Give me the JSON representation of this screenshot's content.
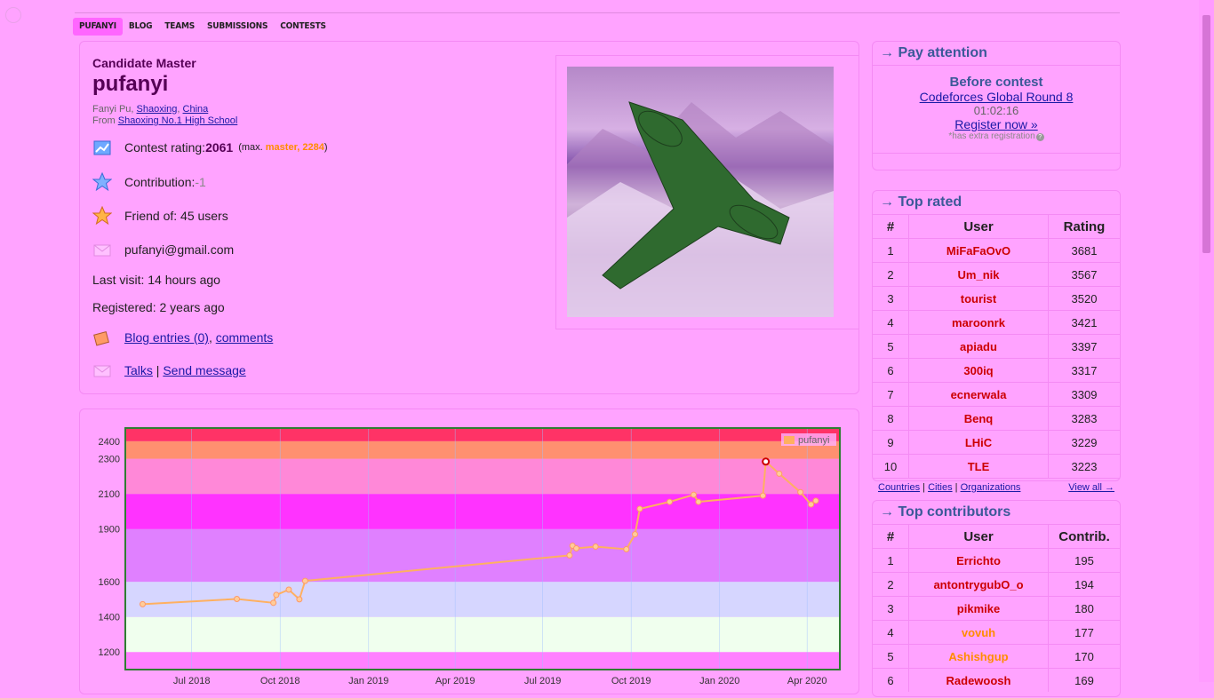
{
  "nav": [
    "PUFANYI",
    "BLOG",
    "TEAMS",
    "SUBMISSIONS",
    "CONTESTS"
  ],
  "profile": {
    "rank": "Candidate Master",
    "handle": "pufanyi",
    "name_prefix": "Fanyi Pu, ",
    "city": "Shaoxing",
    "country": "China",
    "from_prefix": "From ",
    "org": "Shaoxing No.1 High School",
    "contest_rating_label": "Contest rating: ",
    "rating": "2061",
    "max_prefix": "(max. ",
    "max_rank": "master, 2284",
    "max_suffix": ")",
    "contribution_label": "Contribution: ",
    "contribution": "-1",
    "friends": "Friend of: 45 users",
    "email": "pufanyi@gmail.com",
    "last_visit": "Last visit: 14 hours ago",
    "registered": "Registered: 2 years ago",
    "blog_entries": "Blog entries (0)",
    "comments": "comments",
    "talks": "Talks",
    "send_message": "Send message"
  },
  "attention": {
    "title": "Pay attention",
    "before": "Before contest",
    "contest": "Codeforces Global Round 8",
    "timer": "01:02:16",
    "register": "Register now »",
    "extra": "*has extra registration"
  },
  "top_rated": {
    "title": "Top rated",
    "headers": [
      "#",
      "User",
      "Rating"
    ],
    "rows": [
      [
        "1",
        "MiFaFaOvO",
        "3681"
      ],
      [
        "2",
        "Um_nik",
        "3567"
      ],
      [
        "3",
        "tourist",
        "3520"
      ],
      [
        "4",
        "maroonrk",
        "3421"
      ],
      [
        "5",
        "apiadu",
        "3397"
      ],
      [
        "6",
        "300iq",
        "3317"
      ],
      [
        "7",
        "ecnerwala",
        "3309"
      ],
      [
        "8",
        "Benq",
        "3283"
      ],
      [
        "9",
        "LHiC",
        "3229"
      ],
      [
        "10",
        "TLE",
        "3223"
      ]
    ],
    "links": [
      "Countries",
      "Cities",
      "Organizations"
    ],
    "view_all": "View all →"
  },
  "top_contrib": {
    "title": "Top contributors",
    "headers": [
      "#",
      "User",
      "Contrib."
    ],
    "rows": [
      [
        "1",
        "Errichto",
        "195"
      ],
      [
        "2",
        "antontrygubO_o",
        "194"
      ],
      [
        "3",
        "pikmike",
        "180"
      ],
      [
        "4",
        "vovuh",
        "177"
      ],
      [
        "5",
        "Ashishgup",
        "170"
      ],
      [
        "6",
        "Radewoosh",
        "169"
      ]
    ]
  },
  "colors": {
    "accent": "#3b5998",
    "legendary": "#cc0000",
    "master": "#ff8c00"
  },
  "chart_data": {
    "type": "line",
    "series": [
      {
        "name": "pufanyi",
        "x": [
          "2018-05-11",
          "2018-08-17",
          "2018-09-24",
          "2018-09-27",
          "2018-10-10",
          "2018-10-21",
          "2018-10-27",
          "2019-07-29",
          "2019-08-01",
          "2019-08-05",
          "2019-08-25",
          "2019-09-26",
          "2019-10-05",
          "2019-10-10",
          "2019-11-10",
          "2019-12-05",
          "2019-12-10",
          "2020-02-15",
          "2020-02-18",
          "2020-03-03",
          "2020-03-25",
          "2020-04-05",
          "2020-04-10"
        ],
        "values": [
          1472,
          1502,
          1480,
          1525,
          1555,
          1500,
          1605,
          1750,
          1805,
          1790,
          1800,
          1785,
          1870,
          2015,
          2055,
          2095,
          2055,
          2090,
          2284,
          2215,
          2110,
          2040,
          2061
        ]
      }
    ],
    "x_ticks": [
      "Jul 2018",
      "Oct 2018",
      "Jan 2019",
      "Apr 2019",
      "Jul 2019",
      "Oct 2019",
      "Jan 2020",
      "Apr 2020"
    ],
    "y_ticks": [
      1200,
      1400,
      1600,
      1900,
      2100,
      2300,
      2400
    ],
    "ylim": [
      1100,
      2475
    ],
    "legend": "top-right",
    "grid": true
  }
}
